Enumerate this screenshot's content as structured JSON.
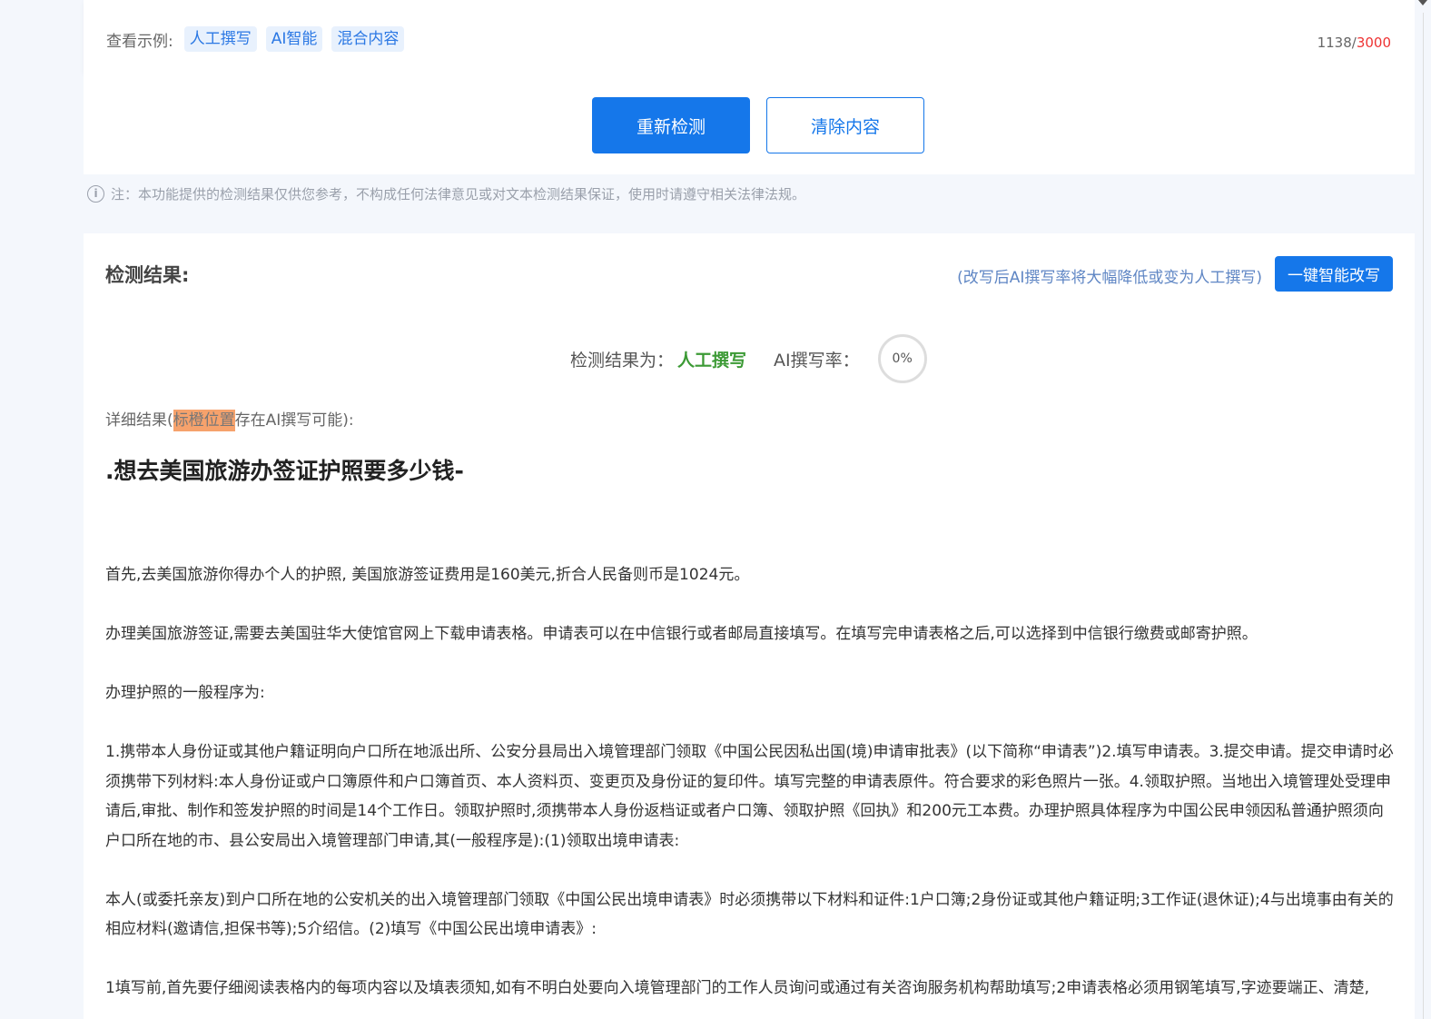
{
  "input_panel": {
    "examples_label": "查看示例:",
    "examples": [
      "人工撰写",
      "AI智能",
      "混合内容"
    ],
    "char_count": "1138",
    "char_separator": "/",
    "char_max": "3000"
  },
  "actions": {
    "recheck_label": "重新检测",
    "clear_label": "清除内容"
  },
  "notice": {
    "icon": "info-icon",
    "text": "注：本功能提供的检测结果仅供您参考，不构成任何法律意见或对文本检测结果保证，使用时请遵守相关法律法规。"
  },
  "result": {
    "title": "检测结果:",
    "rewrite_hint": "(改写后AI撰写率将大幅降低或变为人工撰写)",
    "rewrite_button": "一键智能改写",
    "verdict_label": "检测结果为：",
    "verdict_value": "人工撰写",
    "rate_label": "AI撰写率：",
    "rate_value": "0%",
    "detail_prefix": "详细结果(",
    "detail_highlight": "标橙位置",
    "detail_suffix": "存在AI撰写可能):",
    "doc_title": ".想去美国旅游办签证护照要多少钱-",
    "paragraphs": [
      "首先,去美国旅游你得办个人的护照, 美国旅游签证费用是160美元,折合人民备则币是1024元。",
      "办理美国旅游签证,需要去美国驻华大使馆官网上下载申请表格。申请表可以在中信银行或者邮局直接填写。在填写完申请表格之后,可以选择到中信银行缴费或邮寄护照。",
      "办理护照的一般程序为:",
      "1.携带本人身份证或其他户籍证明向户口所在地派出所、公安分县局出入境管理部门领取《中国公民因私出国(境)申请审批表》(以下简称“申请表”)2.填写申请表。3.提交申请。提交申请时必须携带下列材料:本人身份证或户口簿原件和户口簿首页、本人资料页、变更页及身份证的复印件。填写完整的申请表原件。符合要求的彩色照片一张。4.领取护照。当地出入境管理处受理申请后,审批、制作和签发护照的时间是14个工作日。领取护照时,须携带本人身份返档证或者户口簿、领取护照《回执》和200元工本费。办理护照具体程序为中国公民申领因私普通护照须向户口所在地的市、县公安局出入境管理部门申请,其(一般程序是):(1)领取出境申请表:",
      "本人(或委托亲友)到户口所在地的公安机关的出入境管理部门领取《中国公民出境申请表》时必须携带以下材料和证件:1户口簿;2身份证或其他户籍证明;3工作证(退休证);4与出境事由有关的相应材料(邀请信,担保书等);5介绍信。(2)填写《中国公民出境申请表》:",
      "1填写前,首先要仔细阅读表格内的每项内容以及填表须知,如有不明白处要向入境管理部门的工作人员询问或通过有关咨询服务机构帮助填写;2申请表格必须用钢笔填写,字迹要端正、清楚,"
    ]
  }
}
